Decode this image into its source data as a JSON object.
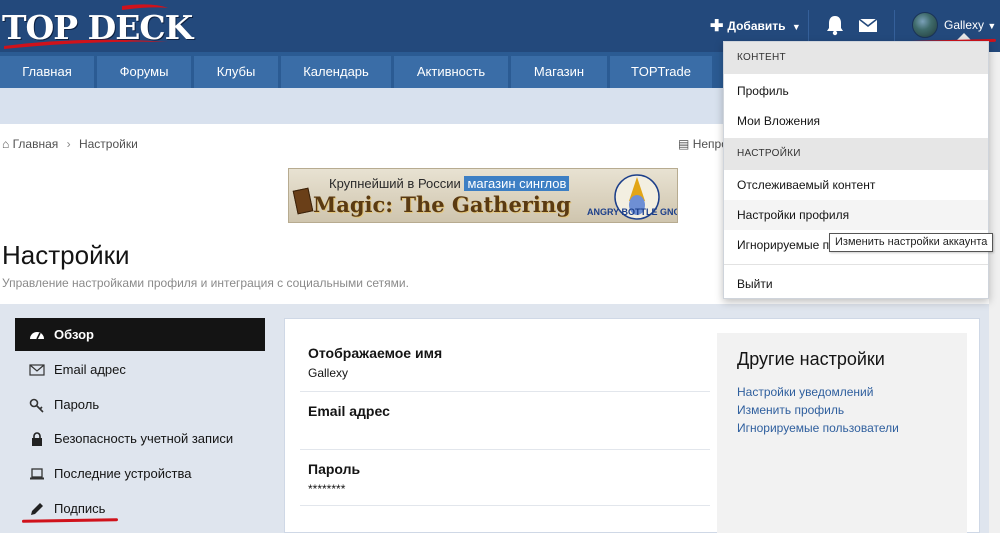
{
  "site": {
    "logo_text": "TOP DECK"
  },
  "header": {
    "add_label": "Добавить",
    "user_name": "Gallexy"
  },
  "nav": {
    "tabs": [
      "Главная",
      "Форумы",
      "Клубы",
      "Календарь",
      "Активность",
      "Магазин",
      "TOPTrade"
    ]
  },
  "breadcrumb": {
    "items": [
      "Главная",
      "Настройки"
    ],
    "unread_text": "Непро"
  },
  "banner": {
    "line1": "Крупнейший в России",
    "line1_highlight": "магазин синглов",
    "line2": "Magic: The Gathering",
    "logo_text": "ANGRY BOTTLE GNOME"
  },
  "page": {
    "title": "Настройки",
    "description": "Управление настройками профиля и интеграция с социальными сетями."
  },
  "sidebar": {
    "items": [
      {
        "label": "Обзор",
        "icon": "dashboard-icon",
        "active": true
      },
      {
        "label": "Email адрес",
        "icon": "envelope-icon"
      },
      {
        "label": "Пароль",
        "icon": "key-icon"
      },
      {
        "label": "Безопасность учетной записи",
        "icon": "lock-icon"
      },
      {
        "label": "Последние устройства",
        "icon": "laptop-icon"
      },
      {
        "label": "Подпись",
        "icon": "pencil-icon"
      }
    ]
  },
  "main": {
    "fields": [
      {
        "label": "Отображаемое имя",
        "value": "Gallexy"
      },
      {
        "label": "Email адрес",
        "value": ""
      },
      {
        "label": "Пароль",
        "value": "********"
      }
    ],
    "other": {
      "title": "Другие настройки",
      "links": [
        "Настройки уведомлений",
        "Изменить профиль",
        "Игнорируемые пользователи"
      ]
    }
  },
  "menu": {
    "content_header": "КОНТЕНТ",
    "content_items": [
      "Профиль",
      "Мои Вложения"
    ],
    "settings_header": "НАСТРОЙКИ",
    "settings_items": [
      "Отслеживаемый контент",
      "Настройки профиля",
      "Игнорируемые п"
    ],
    "logout": "Выйти",
    "tooltip": "Изменить настройки аккаунта"
  },
  "colors": {
    "header_bg": "#23497c",
    "nav_bg": "#2b5b93",
    "nav_tab_bg": "#3a6da7",
    "link": "#2f5f9e",
    "annotation_red": "#d0121b"
  }
}
